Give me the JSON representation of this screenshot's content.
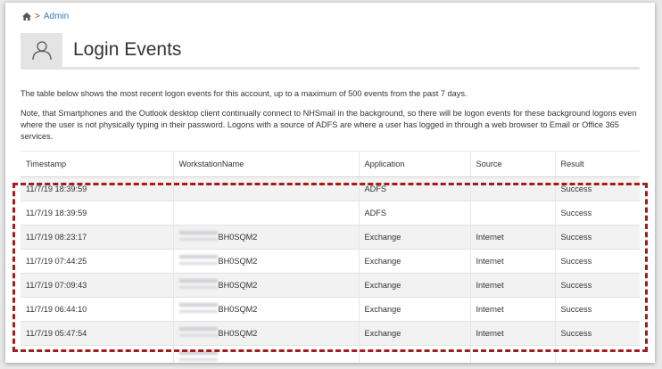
{
  "breadcrumb": {
    "separator": ">",
    "link": "Admin"
  },
  "page": {
    "title": "Login Events"
  },
  "description": {
    "line1": "The table below shows the most recent logon events for this account, up to a maximum of 500 events from the past 7 days.",
    "line2": "Note, that Smartphones and the Outlook desktop client continually connect to NHSmail in the background, so there will be logon events for these background logons even where the user is not physically typing in their password. Logons with a source of ADFS are where a user has logged in through a web browser to Email or Office 365 services."
  },
  "table": {
    "columns": [
      "Timestamp",
      "WorkstationName",
      "Application",
      "Source",
      "Result"
    ],
    "rows": [
      {
        "timestamp": "11/7/19 18:39:59",
        "workstation_suffix": "",
        "application": "ADFS",
        "source": "",
        "result": "Success"
      },
      {
        "timestamp": "11/7/19 18:39:59",
        "workstation_suffix": "",
        "application": "ADFS",
        "source": "",
        "result": "Success"
      },
      {
        "timestamp": "11/7/19 08:23:17",
        "workstation_suffix": "BH0SQM2",
        "application": "Exchange",
        "source": "Internet",
        "result": "Success"
      },
      {
        "timestamp": "11/7/19 07:44:25",
        "workstation_suffix": "BH0SQM2",
        "application": "Exchange",
        "source": "Internet",
        "result": "Success"
      },
      {
        "timestamp": "11/7/19 07:09:43",
        "workstation_suffix": "BH0SQM2",
        "application": "Exchange",
        "source": "Internet",
        "result": "Success"
      },
      {
        "timestamp": "11/7/19 06:44:10",
        "workstation_suffix": "BH0SQM2",
        "application": "Exchange",
        "source": "Internet",
        "result": "Success"
      },
      {
        "timestamp": "11/7/19 05:47:54",
        "workstation_suffix": "BH0SQM2",
        "application": "Exchange",
        "source": "Internet",
        "result": "Success"
      }
    ]
  },
  "colors": {
    "highlight": "#a51c1c",
    "link": "#3a78b8"
  }
}
